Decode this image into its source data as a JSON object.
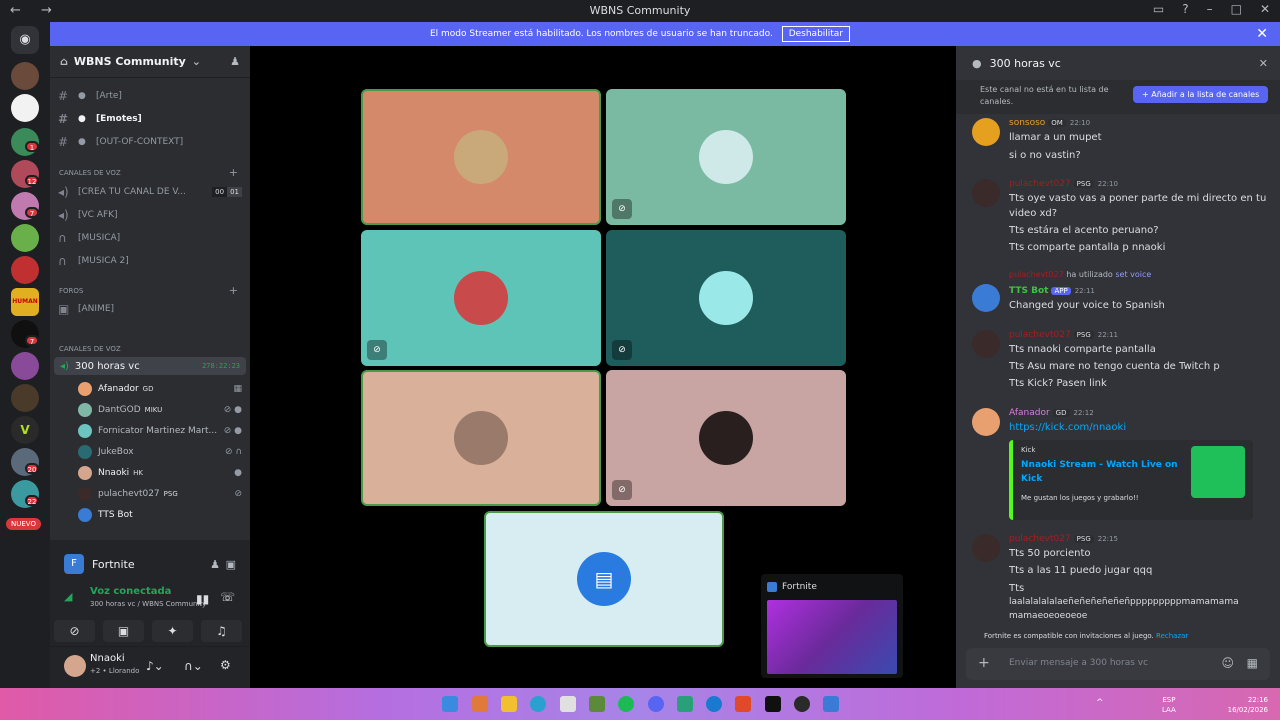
{
  "window": {
    "title": "WBNS Community",
    "nav": "← →"
  },
  "banner": {
    "text": "El modo Streamer está habilitado. Los nombres de usuario se han truncado.",
    "button": "Deshabilitar"
  },
  "server": {
    "name": "WBNS Community"
  },
  "text_channels": [
    {
      "label": "[Arte]"
    },
    {
      "label": "[Emotes]"
    },
    {
      "label": "[OUT-OF-CONTEXT]"
    }
  ],
  "voice_category": "CANALES DE VOZ",
  "voice_channels": [
    {
      "label": "[CREA TU CANAL DE V...",
      "count1": "00",
      "count2": "01"
    },
    {
      "label": "[VC AFK]"
    },
    {
      "label": "[MUSICA]"
    },
    {
      "label": "[MUSICA 2]"
    }
  ],
  "forums_category": "FOROS",
  "forums": [
    {
      "label": "[ANIME]"
    }
  ],
  "voice_category_2": "CANALES DE VOZ",
  "current_vc": {
    "name": "300 horas vc",
    "timer": "278:22:23"
  },
  "vc_users": [
    {
      "name": "Afanador",
      "tag": "GD",
      "color": "#e8a070"
    },
    {
      "name": "DantGOD",
      "tag": "MIKU",
      "color": "#7fb8a6"
    },
    {
      "name": "Fornicator Martinez Mart...",
      "tag": "",
      "color": "#6bc4be"
    },
    {
      "name": "JukeBox",
      "tag": "",
      "color": "#2a6a72"
    },
    {
      "name": "Nnaoki",
      "tag": "HK",
      "color": "#d5a68e"
    },
    {
      "name": "pulachevt027",
      "tag": "PSG",
      "color": "#3a2a2a"
    },
    {
      "name": "TTS Bot",
      "tag": "",
      "color": "#3a7bd5"
    }
  ],
  "nuevo": "NUEVO",
  "activity": {
    "name": "Fortnite"
  },
  "voice_connection": {
    "status": "Voz conectada",
    "detail": "300 horas vc / WBNS Community"
  },
  "user": {
    "name": "Nnaoki",
    "status": "Llorando",
    "extra": "+2"
  },
  "stage_tiles": [
    {
      "bg": "#d4896b",
      "ava": "#c9a87a",
      "muted": false
    },
    {
      "bg": "#7ab9a2",
      "ava": "#cfe8e8",
      "muted": true
    },
    {
      "bg": "#5fc4b8",
      "ava": "#c94a4a",
      "muted": true
    },
    {
      "bg": "#1f5c5c",
      "ava": "#9be8e8",
      "muted": true
    },
    {
      "bg": "#d9b09a",
      "ava": "#9a7a6a",
      "muted": false
    },
    {
      "bg": "#c8a4a2",
      "ava": "#2a1f1f",
      "muted": true
    },
    {
      "bg": "#d7edf2",
      "ava": "#2a7be0",
      "muted": false
    }
  ],
  "pip": {
    "label": "Fortnite"
  },
  "sidepanel": {
    "title": "300 horas vc",
    "notice": "Este canal no está en tu lista de canales.",
    "add_button": "+ Añadir a la lista de canales",
    "input_placeholder": "Enviar mensaje a 300 horas vc",
    "compat": "Fortnite es compatible con invitaciones al juego.",
    "reject": "Rechazar"
  },
  "messages": [
    {
      "author": "sonsoso",
      "tag": "OM",
      "time": "22:10",
      "lines": [
        "llamar a un mupet",
        "si o no vastin?"
      ],
      "color": "#e6a020"
    },
    {
      "author": "pulachevt027",
      "tag": "PSG",
      "time": "22:10",
      "lines": [
        "Tts oye vasto vas a poner parte de mi directo en tu",
        "video xd?",
        "Tts estára el acento peruano?",
        "Tts comparte pantalla p nnaoki"
      ],
      "color": "#a02020"
    },
    {
      "author": "TTS Bot",
      "tag": "APP",
      "time": "22:11",
      "used": "ha utilizado",
      "cmd": "set voice",
      "lines": [
        "Changed your voice to Spanish"
      ],
      "color": "#3ec43e"
    },
    {
      "author": "pulachevt027",
      "tag": "PSG",
      "time": "22:11",
      "lines": [
        "Tts nnaoki comparte pantalla",
        "Tts Asu mare no tengo cuenta de Twitch p",
        "Tts Kick? Pasen link"
      ],
      "color": "#a02020"
    },
    {
      "author": "Afanador",
      "tag": "GD",
      "time": "22:12",
      "link": "https://kick.com/nnaoki",
      "embed": {
        "site": "Kick",
        "title1": "Nnaoki Stream - Watch Live on",
        "title2": "Kick",
        "desc": "Me gustan los juegos y grabarlo!!"
      },
      "color": "#d27fe0"
    },
    {
      "author": "pulachevt027",
      "tag": "PSG",
      "time": "22:15",
      "lines": [
        "Tts 50 porciento",
        "Tts a las 11 puedo jugar qqq",
        "Tts",
        "laalalalalalaeñeñeñeñeñeñpppppppppmamamama",
        "mamaeoeoeoeoe"
      ],
      "color": "#a02020"
    }
  ],
  "taskbar": {
    "lang1": "ESP",
    "lang2": "LAA",
    "time": "22:16",
    "date": "16/02/2026"
  }
}
